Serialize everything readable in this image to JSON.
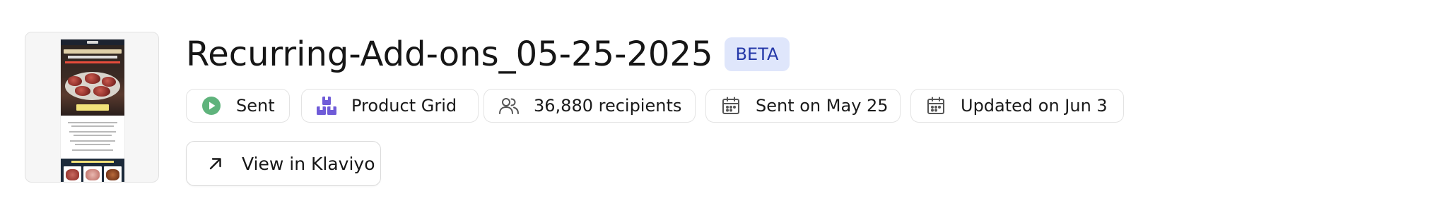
{
  "campaign": {
    "title": "Recurring-Add-ons_05-25-2025",
    "badge": "BETA"
  },
  "chips": {
    "status": {
      "label": "Sent",
      "icon": "play-circle-icon",
      "color": "#5fb37c"
    },
    "template": {
      "label": "Product Grid",
      "icon": "product-grid-icon",
      "color": "#6f5bd8"
    },
    "recipients": {
      "label": "36,880 recipients",
      "icon": "users-icon"
    },
    "sent_on": {
      "label": "Sent on May 25",
      "icon": "calendar-icon"
    },
    "updated_on": {
      "label": "Updated on Jun 3",
      "icon": "calendar-icon"
    }
  },
  "actions": {
    "view_label": "View in Klaviyo",
    "view_icon": "arrow-up-right-icon"
  },
  "thumbnail": {
    "alt": "email preview",
    "icon": "email-preview-thumbnail"
  }
}
